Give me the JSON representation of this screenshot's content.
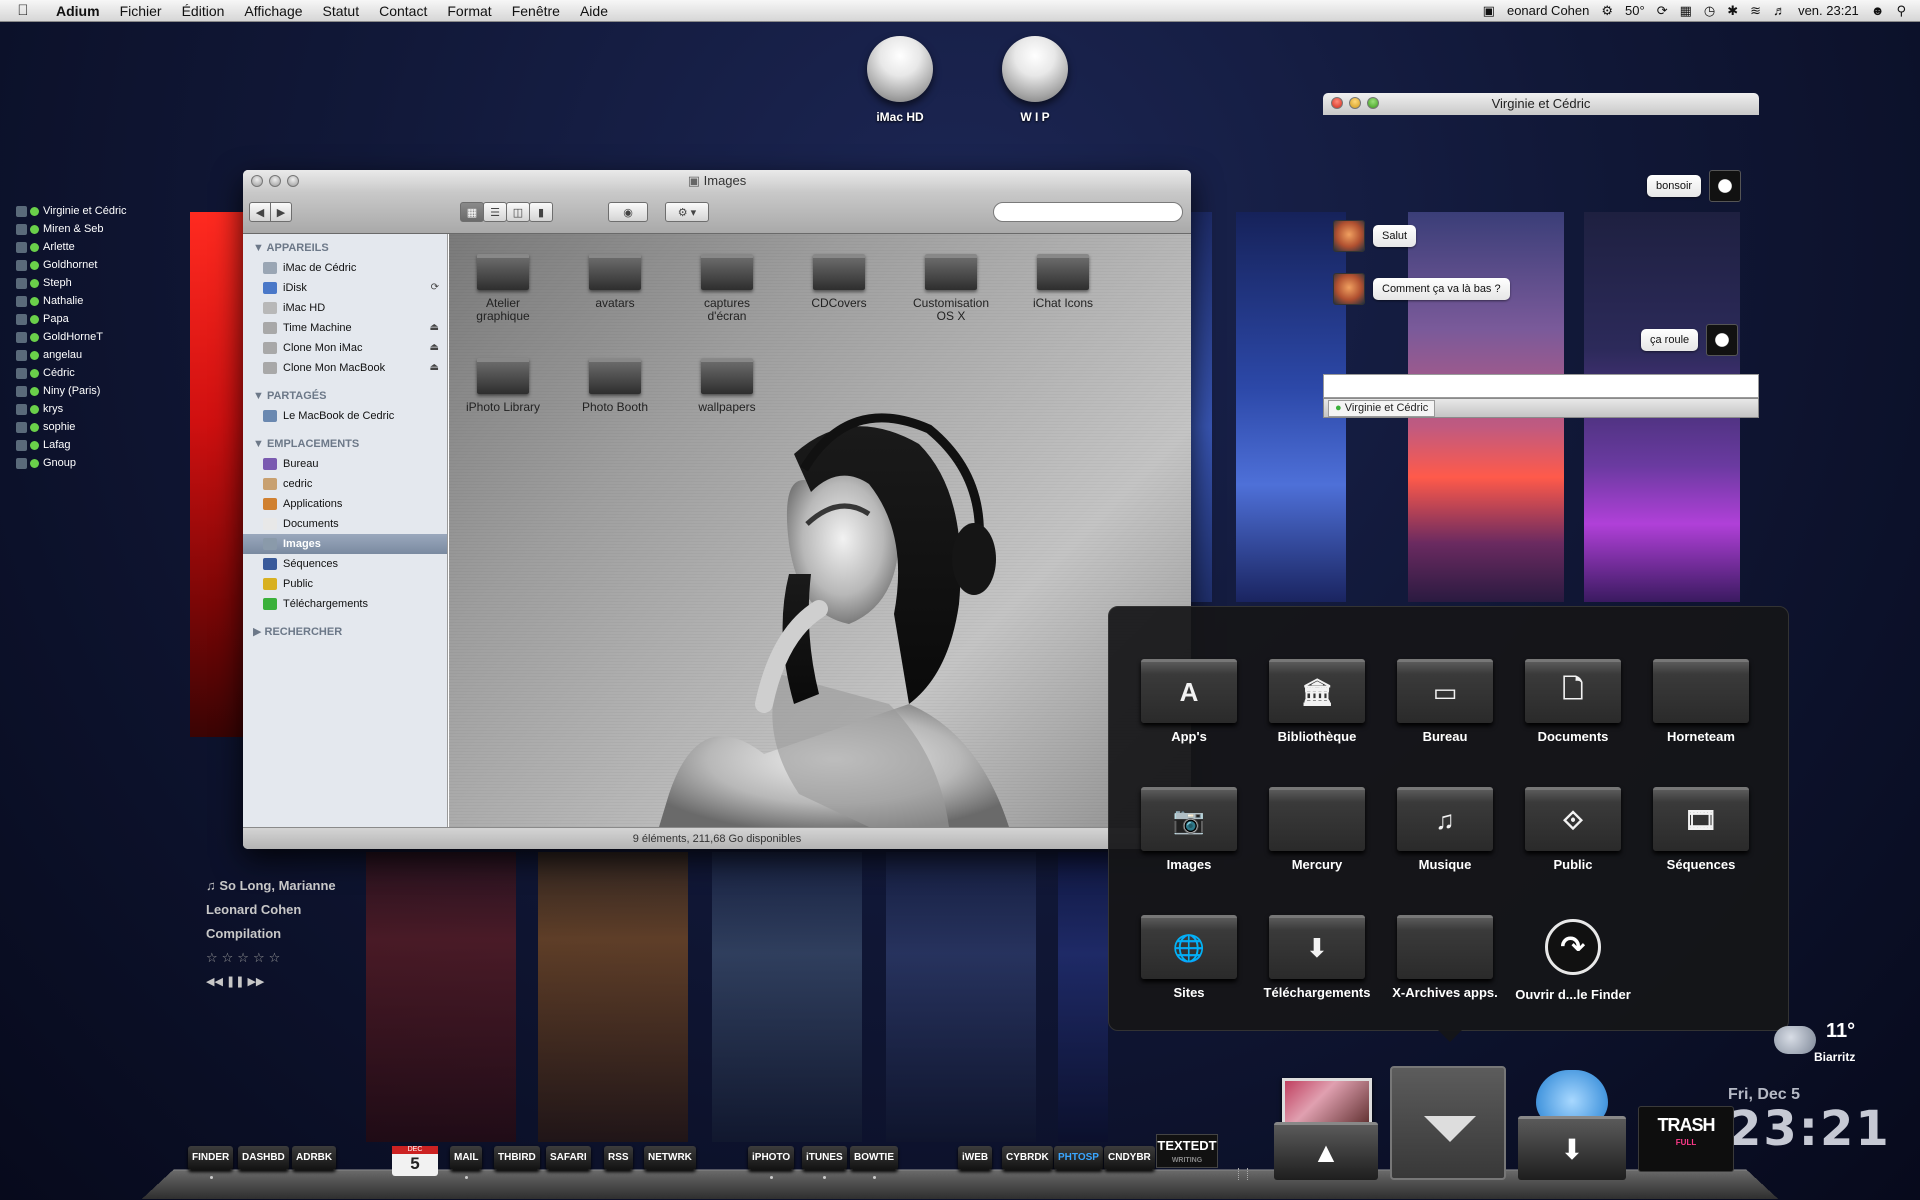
{
  "menubar": {
    "app": "Adium",
    "menus": [
      "Fichier",
      "Édition",
      "Affichage",
      "Statut",
      "Contact",
      "Format",
      "Fenêtre",
      "Aide"
    ],
    "now_playing": "eonard Cohen",
    "temp": "50°",
    "clock": "ven. 23:21"
  },
  "desktop": {
    "disks": [
      "iMac HD",
      "W I P"
    ]
  },
  "buddies": [
    "Virginie et Cédric",
    "Miren & Seb",
    "Arlette",
    "Goldhornet",
    "Steph",
    "Nathalie",
    "Papa",
    "GoldHorneT",
    "angelau",
    "Cédric",
    "Niny (Paris)",
    "krys",
    "sophie",
    "Lafag",
    "Gnoup"
  ],
  "finder": {
    "title": "Images",
    "sections": [
      {
        "title": "APPAREILS",
        "items": [
          "iMac de Cédric",
          "iDisk",
          "iMac HD",
          "Time Machine",
          "Clone Mon iMac",
          "Clone Mon MacBook"
        ]
      },
      {
        "title": "PARTAGÉS",
        "items": [
          "Le MacBook de Cedric"
        ]
      },
      {
        "title": "EMPLACEMENTS",
        "items": [
          "Bureau",
          "cedric",
          "Applications",
          "Documents",
          "Images",
          "Séquences",
          "Public",
          "Téléchargements"
        ]
      },
      {
        "title": "RECHERCHER",
        "items": []
      }
    ],
    "folders": [
      [
        "Atelier",
        "graphique"
      ],
      [
        "avatars"
      ],
      [
        "captures",
        "d'écran"
      ],
      [
        "CDCovers"
      ],
      [
        "Customisation",
        "OS X"
      ],
      [
        "iChat Icons"
      ],
      [
        "iPhoto Library"
      ],
      [
        "Photo Booth"
      ],
      [
        "wallpapers"
      ]
    ],
    "status": "9 éléments, 211,68 Go disponibles"
  },
  "chat": {
    "title": "Virginie et Cédric",
    "messages": [
      "bonsoir",
      "Salut",
      "Comment ça va là bas ?",
      "ça roule"
    ],
    "tab": "Virginie et Cédric"
  },
  "itunes": {
    "track": "So Long, Marianne",
    "artist": "Leonard Cohen",
    "album": "Compilation",
    "stars": "☆☆☆☆☆",
    "controls": "◀◀ ❚❚ ▶▶"
  },
  "stack": {
    "items": [
      "App's",
      "Bibliothèque",
      "Bureau",
      "Documents",
      "Horneteam",
      "Images",
      "Mercury",
      "Musique",
      "Public",
      "Séquences",
      "Sites",
      "Téléchargements",
      "X-Archives apps.",
      "Ouvrir d...le Finder"
    ]
  },
  "weather": {
    "temp": "11°",
    "city": "Biarritz"
  },
  "clock": {
    "date": "Fri, Dec 5",
    "time": "23:21"
  },
  "dock": {
    "labels": [
      "FINDER",
      "DASHBD",
      "ADRBK",
      "MAIL",
      "THBIRD",
      "SAFARI",
      "RSS",
      "NETWRK",
      "iPHOTO",
      "iTUNES",
      "BOWTIE",
      "iWEB",
      "CYBRDK",
      "PHTOSP",
      "CNDYBR"
    ],
    "calendar_month": "DEC",
    "calendar_day": "5",
    "textedit": "TEXTEDT",
    "textedit_sub": "WRITING",
    "trash": "TRASH",
    "trash_sub": "FULL"
  },
  "colors": {
    "accent": "#3aa6ff",
    "trash": "#ff3a8a"
  }
}
